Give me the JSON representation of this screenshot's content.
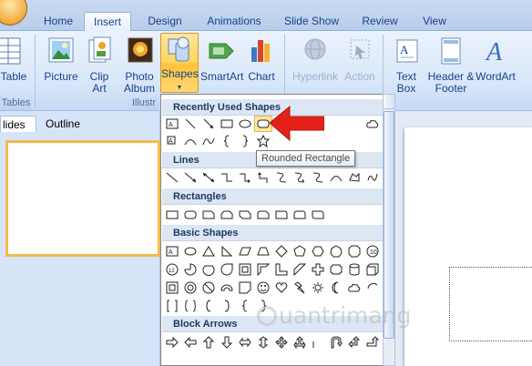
{
  "tabs": [
    "Home",
    "Insert",
    "Design",
    "Animations",
    "Slide Show",
    "Review",
    "View"
  ],
  "active_tab": "Insert",
  "ribbon": {
    "table_label": "Table",
    "picture_label": "Picture",
    "clip_art_label": "Clip Art",
    "photo_album_label": "Photo Album",
    "shapes_label": "Shapes",
    "smartart_label": "SmartArt",
    "chart_label": "Chart",
    "hyperlink_label": "Hyperlink",
    "action_label": "Action",
    "textbox_label": "Text Box",
    "header_footer_label": "Header & Footer",
    "wordart_label": "WordArt",
    "group_tables": "Tables",
    "group_illustrations": "Illustr"
  },
  "left_pane": {
    "slides_tab": "lides",
    "outline_tab": "Outline"
  },
  "dropdown": {
    "sections": {
      "recently_used": "Recently Used Shapes",
      "lines": "Lines",
      "rectangles": "Rectangles",
      "basic_shapes": "Basic Shapes",
      "block_arrows": "Block Arrows"
    },
    "tooltip": "Rounded Rectangle"
  },
  "watermark": "uantrimang",
  "colors": {
    "accent": "#ffd35c",
    "highlight": "#ffe7a2",
    "arrow": "#e32119",
    "header_bg": "#dde7f3"
  }
}
